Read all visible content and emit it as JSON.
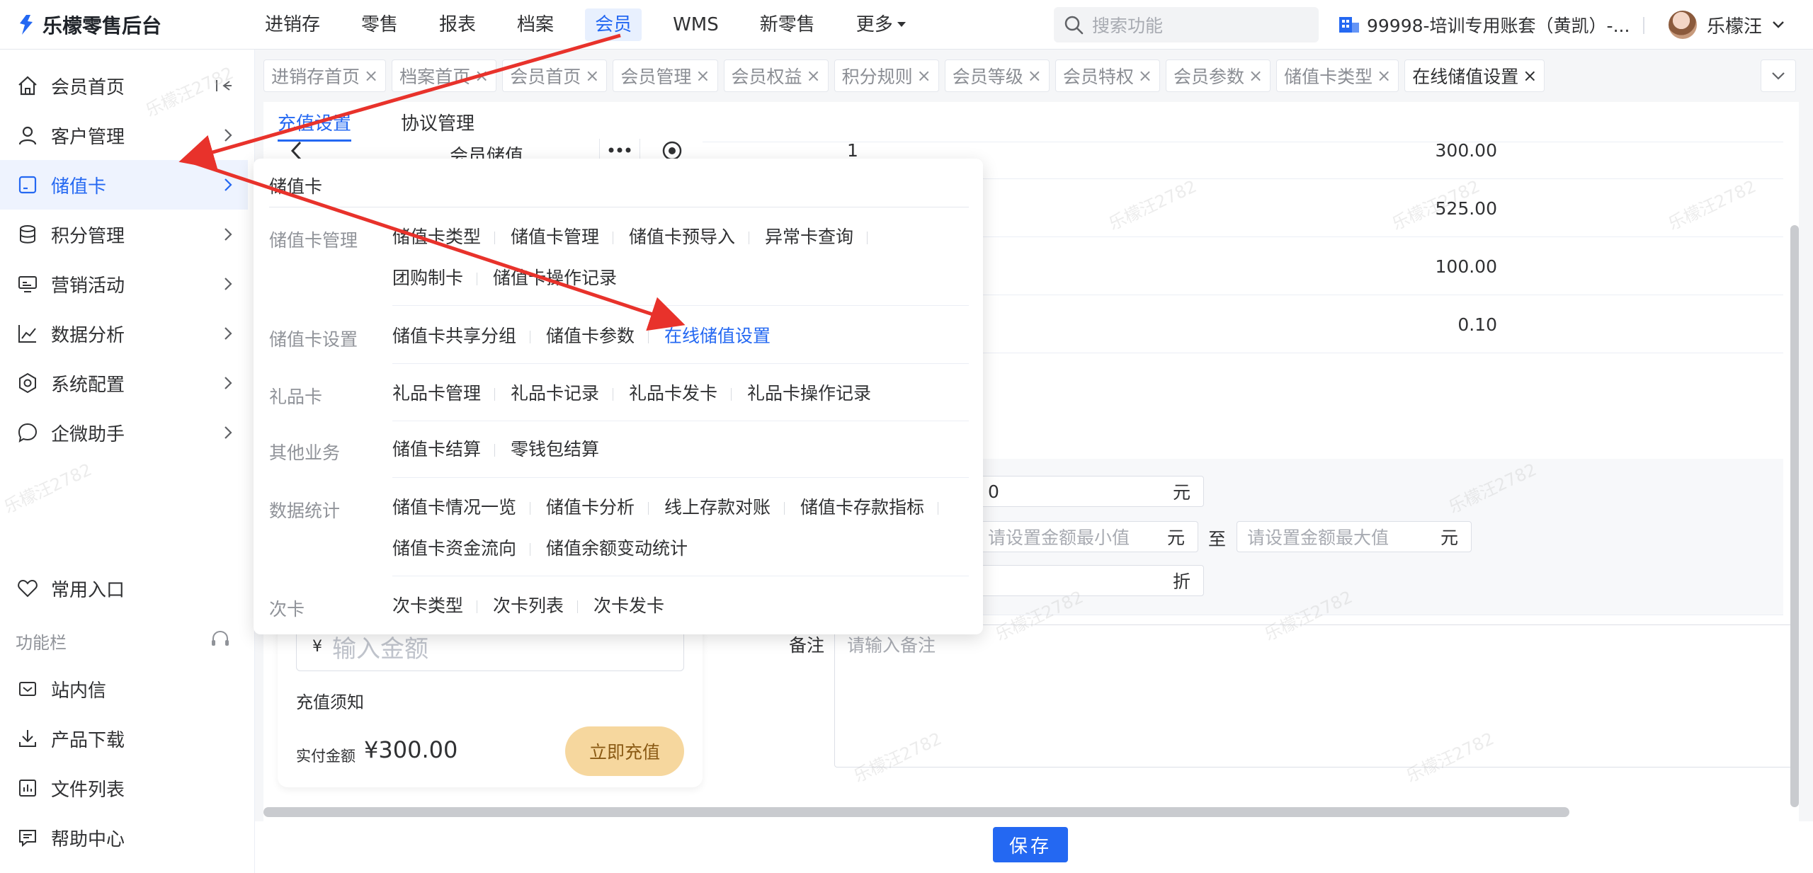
{
  "app": {
    "title": "乐檬零售后台"
  },
  "topnav": {
    "items": [
      "进销存",
      "零售",
      "报表",
      "档案",
      "会员",
      "WMS",
      "新零售",
      "更多"
    ],
    "active_index": 4
  },
  "search": {
    "placeholder": "搜索功能"
  },
  "account": {
    "name": "99998-培训专用账套（黄凯）-..."
  },
  "user": {
    "name": "乐檬汪"
  },
  "sidebar": {
    "items": [
      {
        "label": "会员首页",
        "icon": "home-icon"
      },
      {
        "label": "客户管理",
        "icon": "user-icon"
      },
      {
        "label": "储值卡",
        "icon": "card-icon"
      },
      {
        "label": "积分管理",
        "icon": "database-icon"
      },
      {
        "label": "营销活动",
        "icon": "monitor-icon"
      },
      {
        "label": "数据分析",
        "icon": "line-chart-icon"
      },
      {
        "label": "系统配置",
        "icon": "settings-icon"
      },
      {
        "label": "企微助手",
        "icon": "chat-icon"
      }
    ],
    "active_index": 2,
    "favorites": "常用入口",
    "section_label": "功能栏",
    "tools": [
      {
        "label": "站内信",
        "icon": "mail-icon"
      },
      {
        "label": "产品下载",
        "icon": "download-icon"
      },
      {
        "label": "文件列表",
        "icon": "file-list-icon"
      },
      {
        "label": "帮助中心",
        "icon": "help-icon"
      }
    ]
  },
  "tabs": {
    "items": [
      "进销存首页",
      "档案首页",
      "会员首页",
      "会员管理",
      "会员权益",
      "积分规则",
      "会员等级",
      "会员特权",
      "会员参数",
      "储值卡类型",
      "在线储值设置"
    ],
    "active_index": 10,
    "close": "×"
  },
  "subtabs": {
    "items": [
      "充值设置",
      "协议管理"
    ],
    "active_index": 0
  },
  "phone": {
    "title": "会员储值",
    "amount_currency": "¥",
    "amount_placeholder": "输入金额",
    "notice": "充值须知",
    "paid_label": "实付金额",
    "paid_value": "¥300.00",
    "pay_button": "立即充值"
  },
  "table": {
    "first_index": "1",
    "values": [
      "300.00",
      "525.00",
      "100.00",
      "0.10"
    ]
  },
  "form": {
    "partial_value": "0",
    "unit_yuan": "元",
    "min_placeholder": "请设置金额最小值",
    "max_placeholder": "请设置金额最大值",
    "range_to": "至",
    "unit_discount": "折",
    "remark_label": "备注",
    "remark_placeholder": "请输入备注"
  },
  "dropdown": {
    "title": "储值卡",
    "groups": [
      {
        "category": "储值卡管理",
        "links": [
          "储值卡类型",
          "储值卡管理",
          "储值卡预导入",
          "异常卡查询",
          "团购制卡",
          "储值卡操作记录"
        ]
      },
      {
        "category": "储值卡设置",
        "links": [
          "储值卡共享分组",
          "储值卡参数",
          "在线储值设置"
        ],
        "highlight": "在线储值设置"
      },
      {
        "category": "礼品卡",
        "links": [
          "礼品卡管理",
          "礼品卡记录",
          "礼品卡发卡",
          "礼品卡操作记录"
        ]
      },
      {
        "category": "其他业务",
        "links": [
          "储值卡结算",
          "零钱包结算"
        ]
      },
      {
        "category": "数据统计",
        "links": [
          "储值卡情况一览",
          "储值卡分析",
          "线上存款对账",
          "储值卡存款指标",
          "储值卡资金流向",
          "储值余额变动统计"
        ]
      },
      {
        "category": "次卡",
        "links": [
          "次卡类型",
          "次卡列表",
          "次卡发卡"
        ]
      }
    ]
  },
  "footer": {
    "save": "保存"
  },
  "watermark": "乐檬汪2782",
  "colors": {
    "primary": "#2468f2",
    "annotation_arrow": "#e8322b",
    "pay_button": "#f6d79e"
  }
}
